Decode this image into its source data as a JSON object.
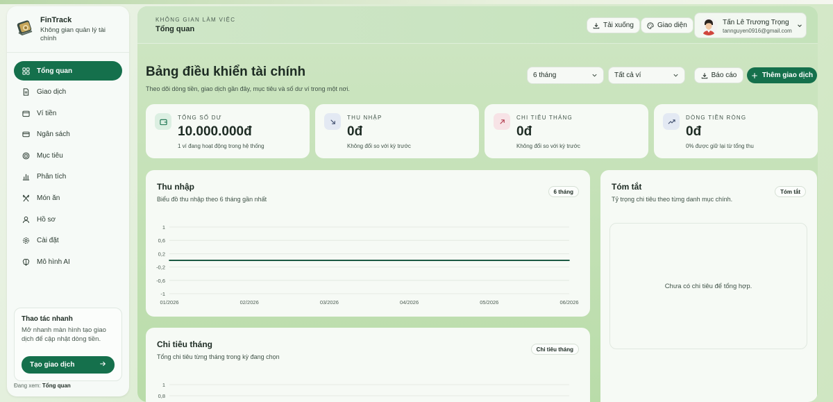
{
  "brand": {
    "name": "FinTrack",
    "subtitle": "Không gian quản lý tài chính"
  },
  "sidebar": {
    "items": [
      {
        "label": "Tổng quan",
        "icon": "grid-icon",
        "active": true
      },
      {
        "label": "Giao dịch",
        "icon": "document-icon",
        "active": false
      },
      {
        "label": "Ví tiền",
        "icon": "wallet-icon",
        "active": false
      },
      {
        "label": "Ngân sách",
        "icon": "card-icon",
        "active": false
      },
      {
        "label": "Mục tiêu",
        "icon": "target-icon",
        "active": false
      },
      {
        "label": "Phân tích",
        "icon": "bar-chart-icon",
        "active": false
      },
      {
        "label": "Món ăn",
        "icon": "utensils-icon",
        "active": false
      },
      {
        "label": "Hồ sơ",
        "icon": "user-icon",
        "active": false
      },
      {
        "label": "Cài đặt",
        "icon": "gear-icon",
        "active": false
      },
      {
        "label": "Mô hình AI",
        "icon": "brain-icon",
        "active": false
      }
    ],
    "quick": {
      "title": "Thao tác nhanh",
      "description": "Mở nhanh màn hình tạo giao dịch để cập nhật dòng tiền.",
      "button": "Tạo giao dịch"
    },
    "viewing_prefix": "Đang xem:",
    "viewing_value": "Tổng quan"
  },
  "header": {
    "workspace_label": "KHÔNG GIAN LÀM VIỆC",
    "workspace_title": "Tổng quan",
    "download": "Tải xuống",
    "theme": "Giao diện",
    "user_name": "Tấn Lê Trương Trọng",
    "user_email": "tannguyen0916@gmail.com"
  },
  "dashboard": {
    "title": "Bảng điều khiển tài chính",
    "subtitle": "Theo dõi dòng tiền, giao dịch gần đây, mục tiêu và số dư ví trong một nơi.",
    "period_select": "6 tháng",
    "wallet_select": "Tất cả ví",
    "report_button": "Báo cáo",
    "add_button": "Thêm giao dịch"
  },
  "stats": [
    {
      "label": "TỔNG SỐ DƯ",
      "value": "10.000.000đ",
      "note": "1 ví đang hoạt động trong hệ thống",
      "icon": "wallet-icon",
      "icon_bg": "#dcefe2",
      "icon_color": "#15704c"
    },
    {
      "label": "THU NHẬP",
      "value": "0đ",
      "note": "Không đổi so với kỳ trước",
      "icon": "arrow-down-right-icon",
      "icon_bg": "#e3e9f3",
      "icon_color": "#3b4a6a"
    },
    {
      "label": "CHI TIÊU THÁNG",
      "value": "0đ",
      "note": "Không đổi so với kỳ trước",
      "icon": "arrow-up-right-icon",
      "icon_bg": "#f7e3e6",
      "icon_color": "#b0384a"
    },
    {
      "label": "DÒNG TIỀN RÒNG",
      "value": "0đ",
      "note": "0% được giữ lại từ tổng thu",
      "icon": "trend-up-icon",
      "icon_bg": "#e3e9f3",
      "icon_color": "#3b4a6a"
    }
  ],
  "income_panel": {
    "title": "Thu nhập",
    "subtitle": "Biểu đồ thu nhập theo 6 tháng gần nhất",
    "chip": "6 tháng"
  },
  "expense_panel": {
    "title": "Chi tiêu tháng",
    "subtitle": "Tổng chi tiêu từng tháng trong kỳ đang chọn",
    "chip": "Chi tiêu tháng"
  },
  "summary_panel": {
    "title": "Tóm tắt",
    "subtitle": "Tỷ trọng chi tiêu theo từng danh mục chính.",
    "chip": "Tóm tắt",
    "empty": "Chưa có chi tiêu để tổng hợp."
  },
  "colors": {
    "accent": "#15704c",
    "line": "#1c5a43"
  },
  "chart_data": [
    {
      "type": "line",
      "categories": [
        "01/2026",
        "02/2026",
        "03/2026",
        "04/2026",
        "05/2026",
        "06/2026"
      ],
      "values": [
        0,
        0,
        0,
        0,
        0,
        0
      ],
      "y_ticks": [
        "1",
        "0,6",
        "0,2",
        "-0,2",
        "-0,6",
        "-1"
      ],
      "ylim": [
        -1,
        1
      ],
      "grid": true
    },
    {
      "type": "bar",
      "y_ticks": [
        "1",
        "0,8"
      ],
      "ylim": [
        0,
        1
      ],
      "grid": true
    }
  ]
}
